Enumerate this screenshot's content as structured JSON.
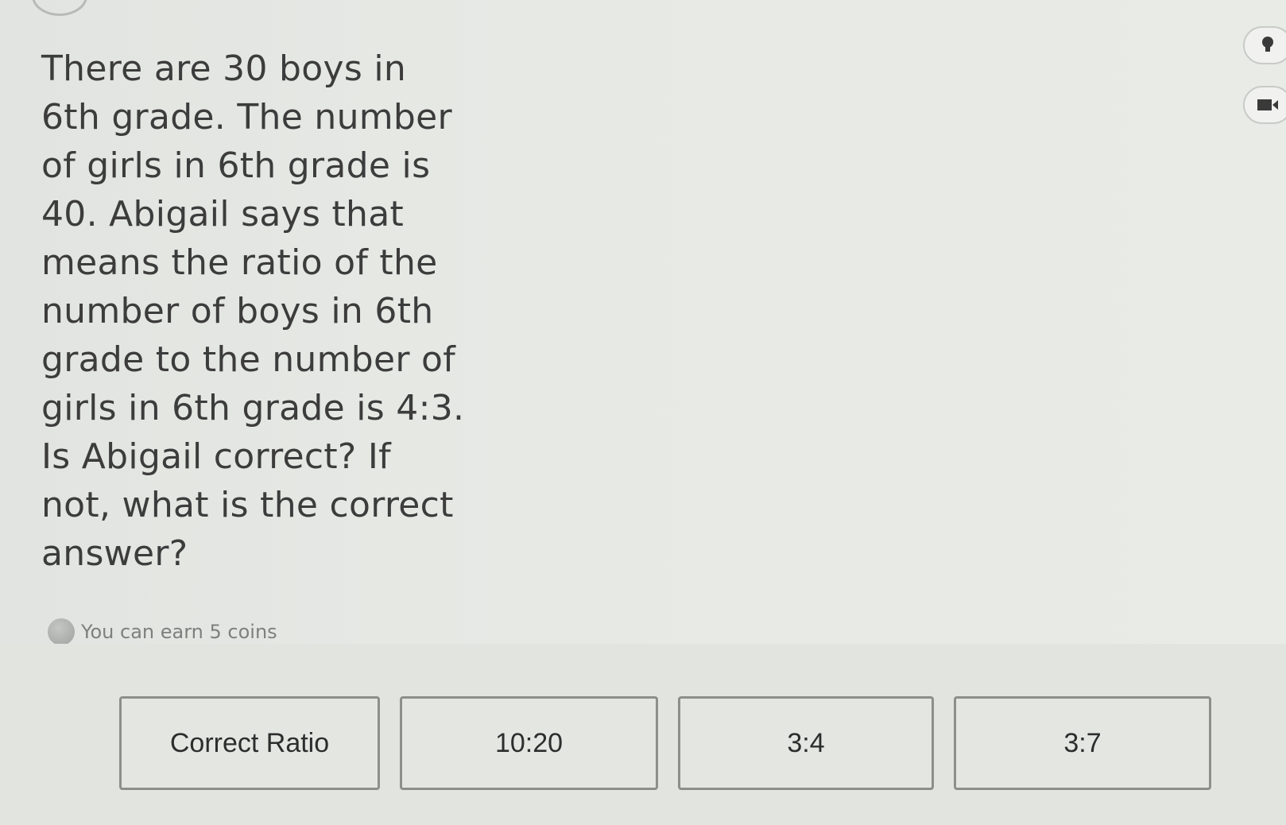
{
  "question": {
    "text": "There are 30 boys in 6th grade. The number of girls in 6th grade is 40. Abigail says that means the ratio of the number of boys in 6th grade to the number of girls in 6th grade is 4:3. Is Abigail correct? If not, what is the correct answer?"
  },
  "coins": {
    "text": "You can earn 5 coins",
    "icon": "coin-icon"
  },
  "side_tools": {
    "hint_icon": "lightbulb-icon",
    "video_icon": "video-camera-icon"
  },
  "answers": [
    {
      "label": "Correct Ratio"
    },
    {
      "label": "10:20"
    },
    {
      "label": "3:4"
    },
    {
      "label": "3:7"
    }
  ],
  "colors": {
    "background": "#e3e5e2",
    "text": "#3c3c3c",
    "button_border": "#8d8f8b",
    "muted_text": "#7e807d"
  }
}
